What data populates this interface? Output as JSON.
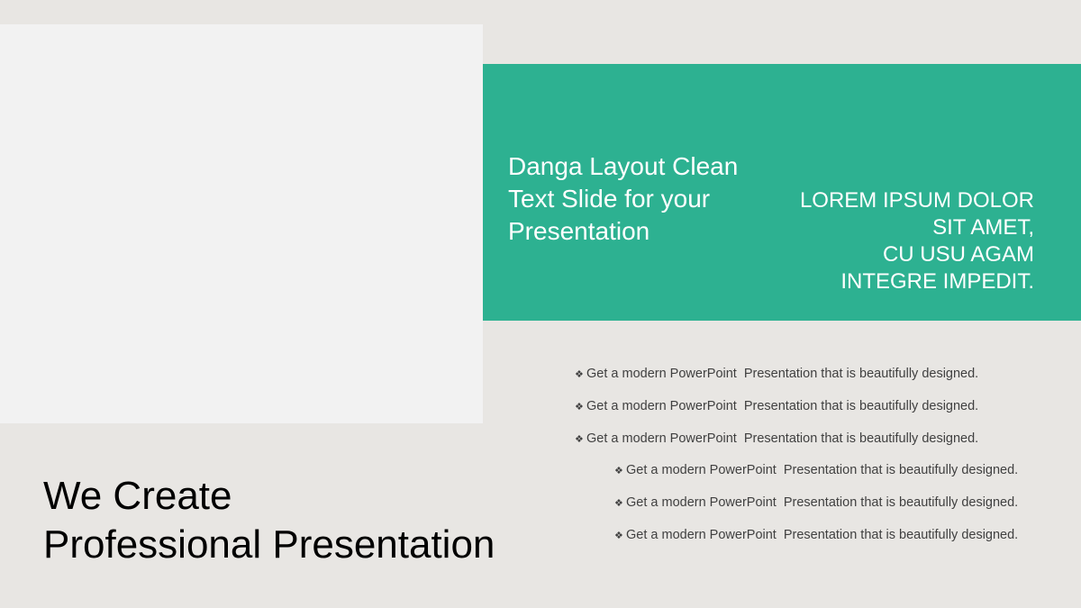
{
  "band": {
    "title": "Danga Layout Clean Text Slide for your Presentation",
    "quote_lines": [
      "LOREM IPSUM DOLOR",
      "SIT AMET,",
      "CU USU AGAM",
      "INTEGRE IMPEDIT."
    ]
  },
  "heading": {
    "line1": "We Create",
    "line2": "Professional Presentation"
  },
  "bullets": [
    {
      "part1": "Get a modern PowerPoint",
      "part2": "Presentation that is beautifully designed."
    },
    {
      "part1": "Get a modern PowerPoint",
      "part2": "Presentation that is beautifully designed."
    },
    {
      "part1": "Get a modern PowerPoint",
      "part2": "Presentation that is beautifully designed."
    },
    {
      "part1": "Get a modern PowerPoint",
      "part2": "Presentation that is beautifully designed."
    },
    {
      "part1": "Get a modern PowerPoint",
      "part2": "Presentation that is beautifully designed."
    },
    {
      "part1": "Get a modern PowerPoint",
      "part2": "Presentation that is beautifully designed."
    }
  ],
  "bullet_icon": "four-diamond-bullet-icon",
  "colors": {
    "background": "#e8e6e3",
    "image_placeholder": "#f2f2f2",
    "accent_green": "#2db191",
    "text_dark": "#000000",
    "text_bullet": "#404040"
  }
}
